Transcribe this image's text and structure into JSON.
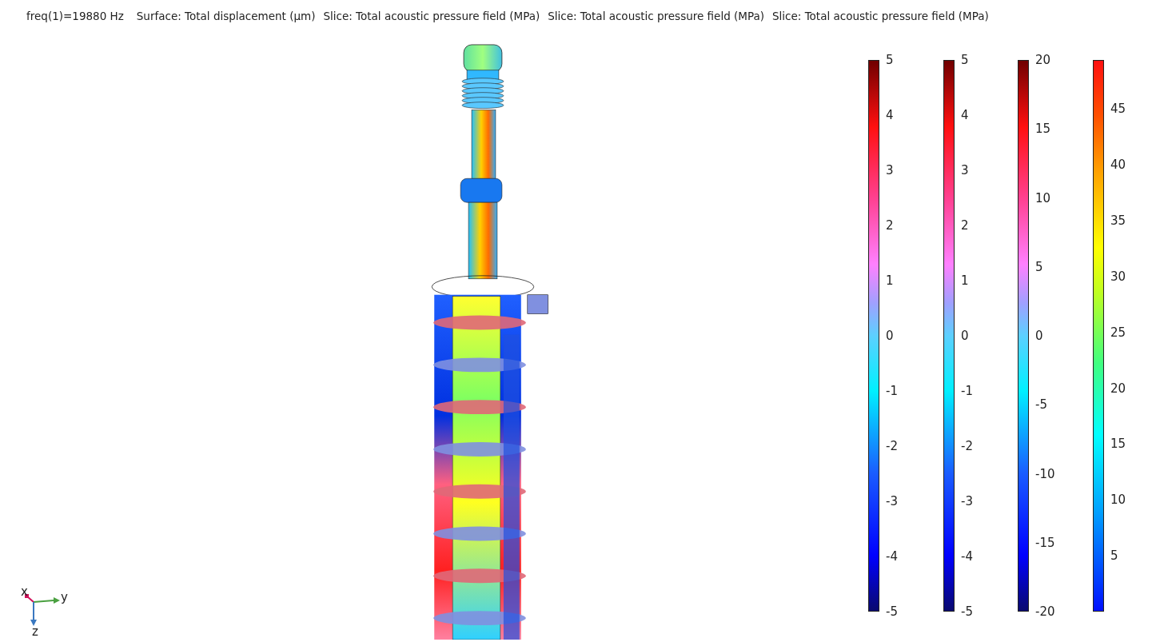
{
  "title_parts": [
    "freq(1)=19880 Hz",
    "Surface: Total displacement (µm)",
    "Slice: Total acoustic pressure field (MPa)",
    "Slice: Total acoustic pressure field (MPa)",
    "Slice: Total acoustic pressure field (MPa)"
  ],
  "legends": [
    {
      "kind": "wave",
      "ticks": [
        "5",
        "4",
        "3",
        "2",
        "1",
        "0",
        "-1",
        "-2",
        "-3",
        "-4",
        "-5"
      ]
    },
    {
      "kind": "wave",
      "ticks": [
        "5",
        "4",
        "3",
        "2",
        "1",
        "0",
        "-1",
        "-2",
        "-3",
        "-4",
        "-5"
      ]
    },
    {
      "kind": "wave",
      "ticks": [
        "20",
        "15",
        "10",
        "5",
        "0",
        "-5",
        "-10",
        "-15",
        "-20"
      ]
    },
    {
      "kind": "rainbow",
      "ticks": [
        "45",
        "40",
        "35",
        "30",
        "25",
        "20",
        "15",
        "10",
        "5"
      ]
    }
  ],
  "axes": {
    "x": "x",
    "y": "y",
    "z": "z"
  }
}
